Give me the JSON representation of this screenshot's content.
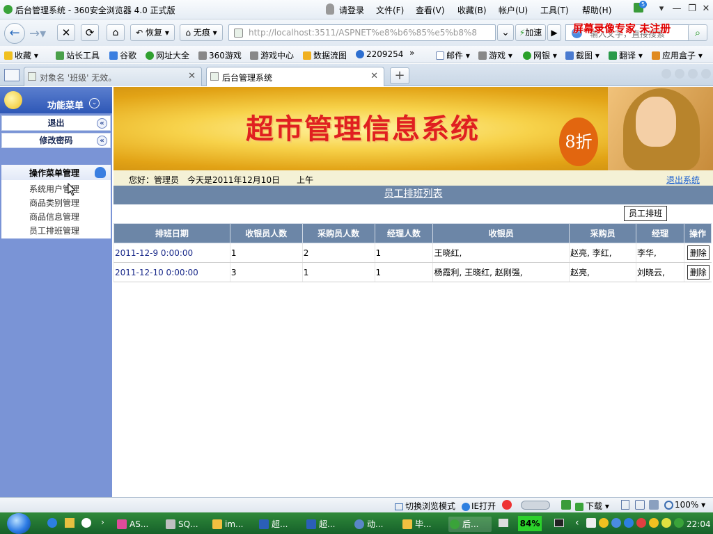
{
  "window": {
    "title": "后台管理系统 - 360安全浏览器 4.0 正式版",
    "menu": [
      "请登录",
      "文件(F)",
      "查看(V)",
      "收藏(B)",
      "帐户(U)",
      "工具(T)",
      "帮助(H)"
    ],
    "badge": "5"
  },
  "nav": {
    "restore": "恢复",
    "notrace": "无痕",
    "url": "http://localhost:3511/ASPNET%e8%b6%85%e5%b8%8",
    "speed": "加速",
    "search_placeholder": "输入文字，直接搜索"
  },
  "watermark": "屏幕录像专家 未注册",
  "bookmarks": {
    "left": [
      "收藏",
      "站长工具",
      "谷歌",
      "网址大全",
      "360游戏",
      "游戏中心",
      "数据流图",
      "2209254"
    ],
    "more": "»",
    "right": [
      "邮件",
      "游戏",
      "网银",
      "截图",
      "翻译",
      "应用盒子"
    ]
  },
  "tabs": [
    {
      "label": "对象名 '班级' 无效。"
    },
    {
      "label": "后台管理系统"
    }
  ],
  "sidebar": {
    "header": "功能菜单",
    "items": [
      {
        "label": "退出"
      },
      {
        "label": "修改密码"
      }
    ],
    "section_title": "操作菜单管理",
    "links": [
      "系统用户管理",
      "商品类别管理",
      "商品信息管理",
      "员工排班管理"
    ]
  },
  "banner": {
    "title": "超市管理信息系统",
    "discount": "8折"
  },
  "strip": {
    "greeting": "您好：管理员　今天是2011年12月10日　　上午",
    "logout": "退出系统"
  },
  "list": {
    "title": "员工排班列表",
    "schedule_button": "员工排班",
    "columns": [
      "排班日期",
      "收银员人数",
      "采购员人数",
      "经理人数",
      "收银员",
      "采购员",
      "经理",
      "操作"
    ],
    "rows": [
      {
        "date": "2011-12-9 0:00:00",
        "cashiers": "1",
        "buyers": "2",
        "managers": "1",
        "cashier_names": "王晓红,",
        "buyer_names": "赵亮, 李红,",
        "manager_names": "李华,",
        "action": "删除"
      },
      {
        "date": "2011-12-10 0:00:00",
        "cashiers": "3",
        "buyers": "1",
        "managers": "1",
        "cashier_names": "杨霞利, 王晓红, 赵刚强,",
        "buyer_names": "赵亮,",
        "manager_names": "刘晓云,",
        "action": "删除"
      }
    ]
  },
  "statusbar": {
    "switch_mode": "切换浏览模式",
    "ie_open": "IE打开",
    "download": "下载",
    "zoom": "100%"
  },
  "taskbar": {
    "items": [
      "AS...",
      "SQ...",
      "im...",
      "超...",
      "超...",
      "动...",
      "毕...",
      "后..."
    ],
    "battery": "84%",
    "clock": "22:04"
  }
}
